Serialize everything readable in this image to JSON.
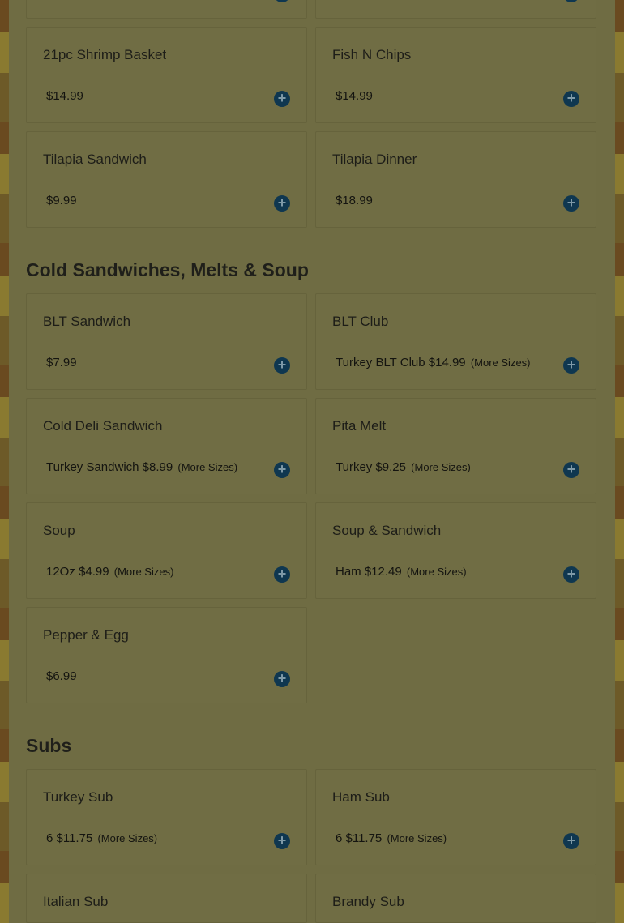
{
  "sections": [
    {
      "title": "",
      "cards": [
        {
          "name": "21pc Shrimp Basket",
          "price": "$14.99",
          "more": ""
        },
        {
          "name": "Fish N Chips",
          "price": "$14.99",
          "more": ""
        },
        {
          "name": "Tilapia Sandwich",
          "price": "$9.99",
          "more": ""
        },
        {
          "name": "Tilapia Dinner",
          "price": "$18.99",
          "more": ""
        }
      ]
    },
    {
      "title": "Cold Sandwiches, Melts & Soup",
      "cards": [
        {
          "name": "BLT Sandwich",
          "price": "$7.99",
          "more": ""
        },
        {
          "name": "BLT Club",
          "price": "Turkey BLT Club $14.99",
          "more": "(More Sizes)"
        },
        {
          "name": "Cold Deli Sandwich",
          "price": "Turkey Sandwich $8.99",
          "more": "(More Sizes)"
        },
        {
          "name": "Pita Melt",
          "price": "Turkey $9.25",
          "more": "(More Sizes)"
        },
        {
          "name": "Soup",
          "price": "12Oz $4.99",
          "more": "(More Sizes)"
        },
        {
          "name": "Soup & Sandwich",
          "price": "Ham $12.49",
          "more": "(More Sizes)"
        },
        {
          "name": "Pepper & Egg",
          "price": "$6.99",
          "more": ""
        }
      ]
    },
    {
      "title": "Subs",
      "cards": [
        {
          "name": "Turkey Sub",
          "price": "6 $11.75",
          "more": "(More Sizes)"
        },
        {
          "name": "Ham Sub",
          "price": "6 $11.75",
          "more": "(More Sizes)"
        },
        {
          "name": "Italian Sub",
          "price": "",
          "more": ""
        },
        {
          "name": "Brandy Sub",
          "price": "",
          "more": ""
        }
      ]
    }
  ],
  "add_glyph": "+",
  "icons": {
    "add": "plus-circle-icon"
  },
  "colors": {
    "add_button": "#0f3750",
    "section_title": "#1f1f1a"
  }
}
